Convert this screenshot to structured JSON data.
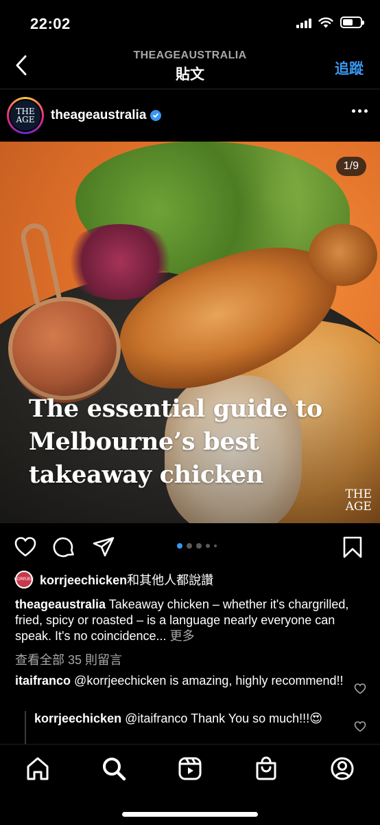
{
  "status_bar": {
    "time": "22:02",
    "battery_level": 0.6
  },
  "header": {
    "subtitle": "THEAGEAUSTRALIA",
    "title": "貼文",
    "follow_label": "追蹤"
  },
  "post": {
    "account": {
      "username": "theageaustralia",
      "avatar_line1": "THE",
      "avatar_line2": "AGE",
      "verified": true
    },
    "image": {
      "page_counter": "1/9",
      "headline": "The essential guide to Melbourne’s best takeaway chicken",
      "brand_line1": "THE",
      "brand_line2": "AGE"
    },
    "carousel": {
      "total_visible_dots": 5,
      "active_index": 0
    },
    "likes": {
      "user": "korrjeechicken",
      "suffix": "和其他人都說讚",
      "avatar_text": "KORRJEE"
    },
    "caption": {
      "username": "theageaustralia",
      "text": "Takeaway chicken – whether it's chargrilled, fried, spicy or roasted – is a language nearly everyone can speak. It's no coincidence...",
      "more": "更多"
    },
    "view_comments": "查看全部 35 則留言",
    "comments": [
      {
        "username": "itaifranco",
        "text": "@korrjeechicken is amazing, highly recommend!!"
      },
      {
        "username": "korrjeechicken",
        "text": "@itaifranco Thank You so much!!!😍"
      }
    ]
  },
  "colors": {
    "accent": "#3897f0",
    "background": "#000000",
    "muted_text": "#a8a8a8",
    "active_dot": "#3897f0"
  },
  "tab_bar": {
    "items": [
      "home-icon",
      "search-icon",
      "reels-icon",
      "shop-icon",
      "profile-icon"
    ]
  }
}
